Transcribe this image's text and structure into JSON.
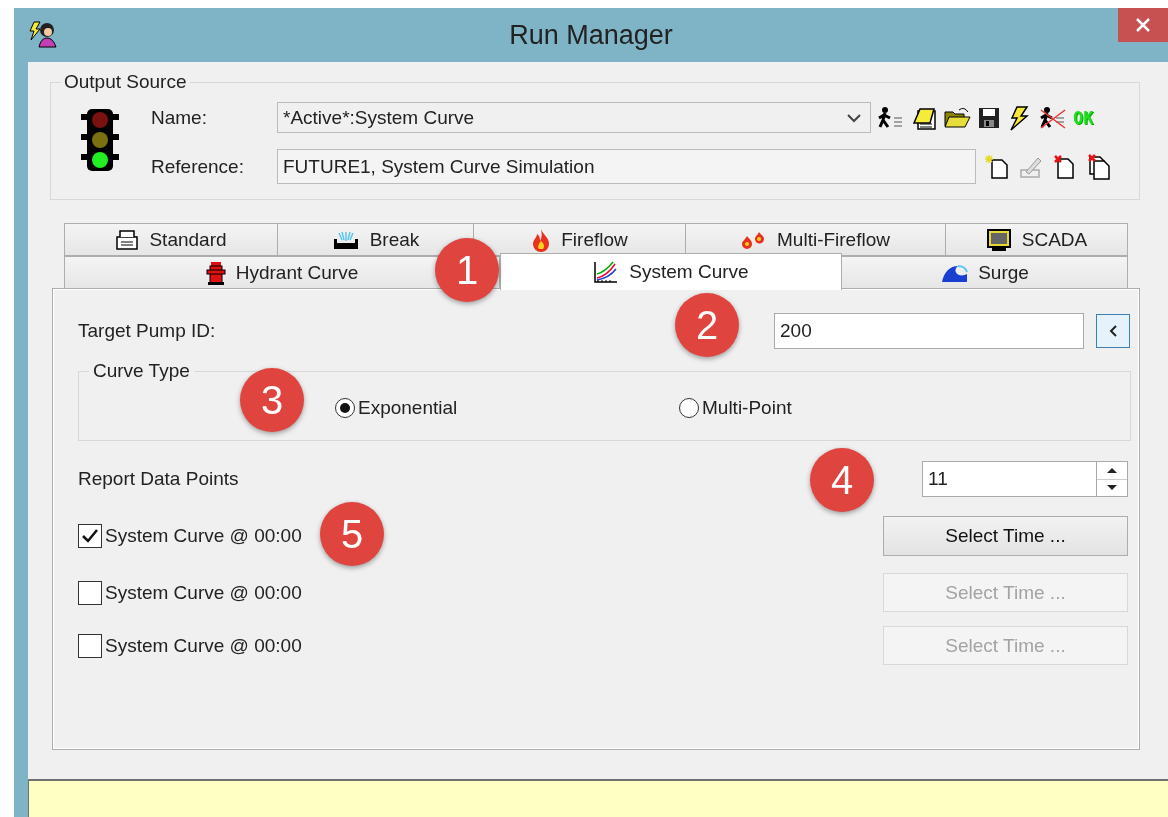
{
  "window": {
    "title": "Run Manager"
  },
  "output_source": {
    "legend": "Output Source",
    "name_label": "Name:",
    "name_value": "*Active*:System Curve",
    "reference_label": "Reference:",
    "reference_value": "FUTURE1, System Curve Simulation",
    "ok_label": "OK"
  },
  "tab_rows": [
    {
      "tabs": [
        {
          "label": "Standard",
          "selected": false
        },
        {
          "label": "Break",
          "selected": false
        },
        {
          "label": "Fireflow",
          "selected": false
        },
        {
          "label": "Multi-Fireflow",
          "selected": false
        },
        {
          "label": "SCADA",
          "selected": false
        }
      ]
    },
    {
      "tabs": [
        {
          "label": "Hydrant Curve",
          "selected": false
        },
        {
          "label": "System Curve",
          "selected": true
        },
        {
          "label": "Surge",
          "selected": false
        }
      ]
    }
  ],
  "system_curve": {
    "target_pump_label": "Target Pump ID:",
    "target_pump_value": "200",
    "curve_type": {
      "legend": "Curve Type",
      "options": [
        {
          "label": "Exponential",
          "selected": true
        },
        {
          "label": "Multi-Point",
          "selected": false
        }
      ]
    },
    "report_points_label": "Report Data Points",
    "report_points_value": "11",
    "curves": [
      {
        "label": "System Curve @ 00:00",
        "checked": true,
        "button": "Select Time ...",
        "disabled": false
      },
      {
        "label": "System Curve @ 00:00",
        "checked": false,
        "button": "Select Time ...",
        "disabled": true
      },
      {
        "label": "System Curve @ 00:00",
        "checked": false,
        "button": "Select Time ...",
        "disabled": true
      }
    ]
  },
  "annotations": [
    {
      "label": "1"
    },
    {
      "label": "2"
    },
    {
      "label": "3"
    },
    {
      "label": "4"
    },
    {
      "label": "5"
    }
  ]
}
